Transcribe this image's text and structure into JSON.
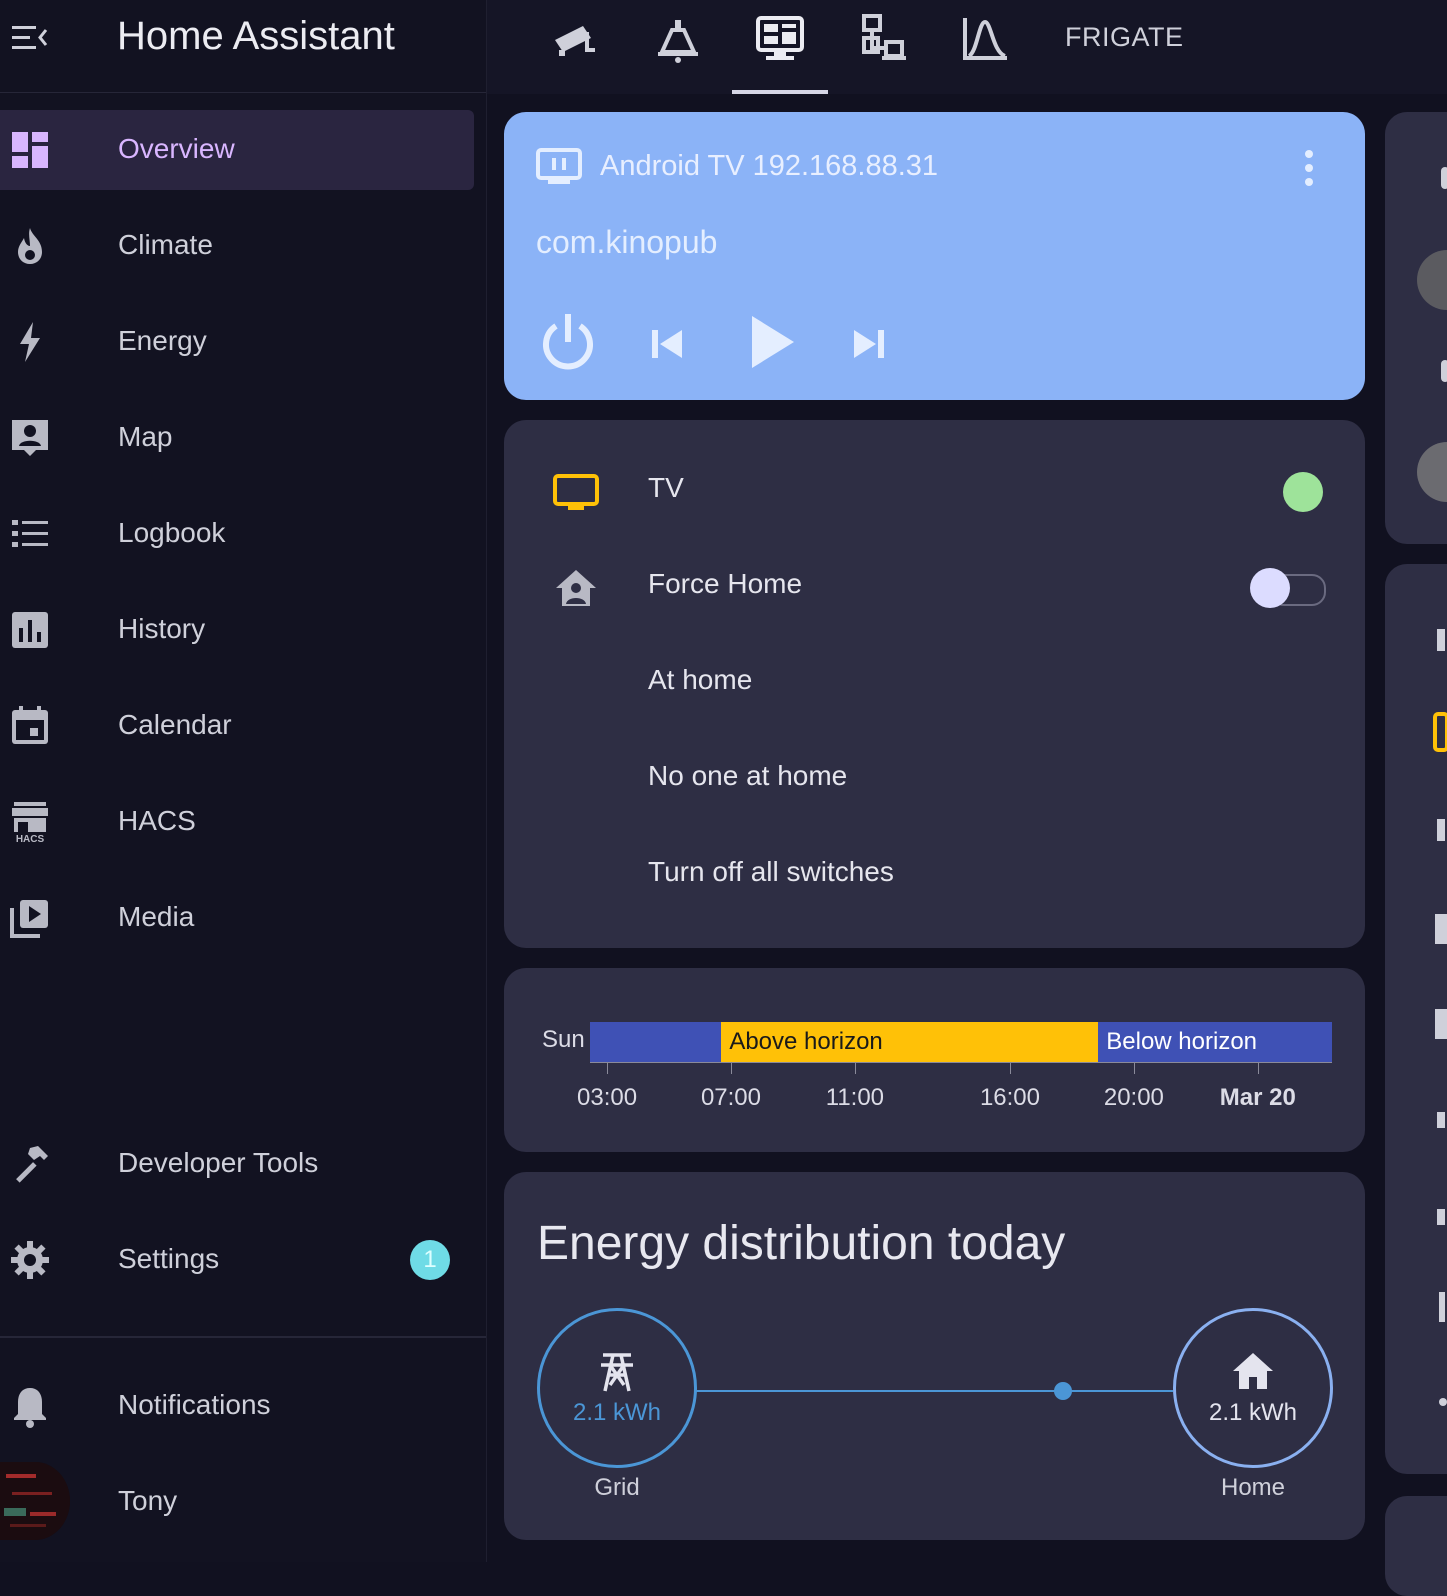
{
  "app": {
    "title": "Home Assistant"
  },
  "sidebar": {
    "items": [
      {
        "label": "Overview",
        "icon": "dashboard-icon",
        "active": true
      },
      {
        "label": "Climate",
        "icon": "fire-icon"
      },
      {
        "label": "Energy",
        "icon": "lightning-icon"
      },
      {
        "label": "Map",
        "icon": "map-person-icon"
      },
      {
        "label": "Logbook",
        "icon": "list-icon"
      },
      {
        "label": "History",
        "icon": "chart-box-icon"
      },
      {
        "label": "Calendar",
        "icon": "calendar-icon"
      },
      {
        "label": "HACS",
        "icon": "hacs-store-icon"
      },
      {
        "label": "Media",
        "icon": "play-box-multiple-icon"
      }
    ],
    "bottom": [
      {
        "label": "Developer Tools",
        "icon": "hammer-icon"
      },
      {
        "label": "Settings",
        "icon": "gear-icon",
        "badge": "1"
      },
      {
        "label": "Notifications",
        "icon": "bell-icon"
      },
      {
        "label": "Tony",
        "icon": "avatar"
      }
    ]
  },
  "topbar": {
    "tabs": [
      {
        "icon": "cctv-icon"
      },
      {
        "icon": "ceiling-light-icon"
      },
      {
        "icon": "monitor-dashboard-icon",
        "active": true
      },
      {
        "icon": "lan-icon"
      },
      {
        "icon": "chart-bell-curve-icon"
      }
    ],
    "frigate": "FRIGATE"
  },
  "media": {
    "title": "Android TV 192.168.88.31",
    "subtitle": "com.kinopub",
    "color": "#8bb3f7"
  },
  "entities": {
    "rows": [
      {
        "label": "TV",
        "icon": "tv-icon",
        "state": "on"
      },
      {
        "label": "Force Home",
        "icon": "home-account-icon",
        "toggle": false
      },
      {
        "label": "At home"
      },
      {
        "label": "No one at home"
      },
      {
        "label": "Turn off all switches"
      }
    ]
  },
  "sun": {
    "label": "Sun",
    "segments": [
      {
        "label": "",
        "start": 0,
        "end": 0.177,
        "color": "#3f51b5"
      },
      {
        "label": "Above horizon",
        "start": 0.177,
        "end": 0.685,
        "color": "#ffc107"
      },
      {
        "label": "Below horizon",
        "start": 0.685,
        "end": 1.0,
        "color": "#3f51b5"
      }
    ],
    "ticks": [
      {
        "label": "03:00",
        "pos": 0.023
      },
      {
        "label": "07:00",
        "pos": 0.19
      },
      {
        "label": "11:00",
        "pos": 0.357
      },
      {
        "label": "16:00",
        "pos": 0.566
      },
      {
        "label": "20:00",
        "pos": 0.733
      },
      {
        "label": "Mar 20",
        "pos": 0.9,
        "bold": true
      }
    ]
  },
  "energy": {
    "title": "Energy distribution today",
    "grid": {
      "value": "2.1 kWh",
      "label": "Grid",
      "color": "#4b96d6"
    },
    "home": {
      "value": "2.1 kWh",
      "label": "Home",
      "color": "#8ab0f0"
    }
  }
}
